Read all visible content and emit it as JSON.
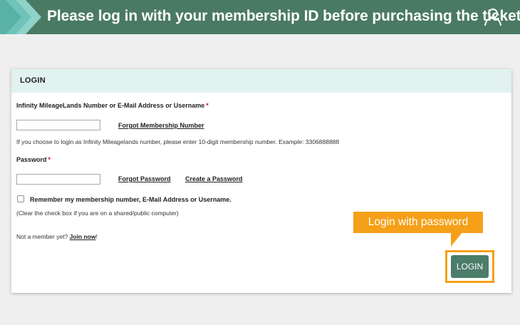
{
  "banner": {
    "title": "Please log in with your membership ID before purchasing the ticket",
    "icon": "user-icon",
    "bg_color": "#4a7a64"
  },
  "form": {
    "header": "LOGIN",
    "id_label": "Infinity MileageLands Number or E-Mail Address or Username",
    "required_marker": "*",
    "id_value": "",
    "forgot_membership_link": "Forgot Membership Number",
    "id_hint": "If you choose to login as Infinity Mileagelands number, please enter 10-digit membership number. Example: 3306888888",
    "password_label": "Password",
    "password_value": "",
    "forgot_password_link": "Forgot Password",
    "create_password_link": "Create a Password",
    "remember_label": "Remember my membership number, E-Mail Address or Username.",
    "remember_checked": false,
    "remember_hint": "(Clear the check box if you are on a shared/public computer)",
    "not_member_text": "Not a member yet?",
    "join_now_link": "Join now",
    "join_suffix": "!",
    "login_button": "LOGIN"
  },
  "tooltip": {
    "text": "Login with password",
    "color": "#f5a018"
  },
  "colors": {
    "accent": "#4c7c6a",
    "header_bg": "#e2f2f0",
    "required": "#c8102e",
    "highlight": "#f5a018"
  }
}
